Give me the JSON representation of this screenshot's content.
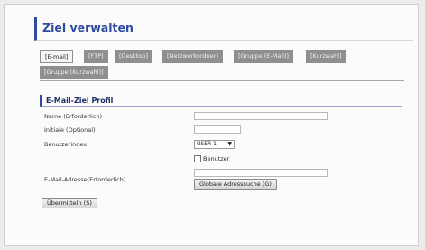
{
  "page": {
    "title": "Ziel verwalten"
  },
  "tabs": [
    {
      "label": "[E-mail]",
      "active": true
    },
    {
      "label": "[FTP]",
      "active": false
    },
    {
      "label": "[Desktop]",
      "active": false
    },
    {
      "label": "[Netzwerkordner]",
      "active": false
    },
    {
      "label": "[Gruppe (E-Mail)]",
      "active": false
    },
    {
      "label": "[Kurzwahl]",
      "active": false
    },
    {
      "label": "[Gruppe (Kurzwahl)]",
      "active": false
    }
  ],
  "section": {
    "title": "E-Mail-Ziel Profil"
  },
  "form": {
    "name": {
      "label": "Name (Erforderlich)",
      "value": ""
    },
    "initials": {
      "label": "Initiale (Optional)",
      "value": ""
    },
    "user_index": {
      "label": "Benutzerindex",
      "selected": "USER 1",
      "checkbox_label": "Benutzer"
    },
    "email": {
      "label": "E-Mail-Adresse(Erforderlich)",
      "value": "",
      "lookup_button": "Globale Adresssuche (G)"
    },
    "submit_label": "Übermitteln (S)"
  }
}
